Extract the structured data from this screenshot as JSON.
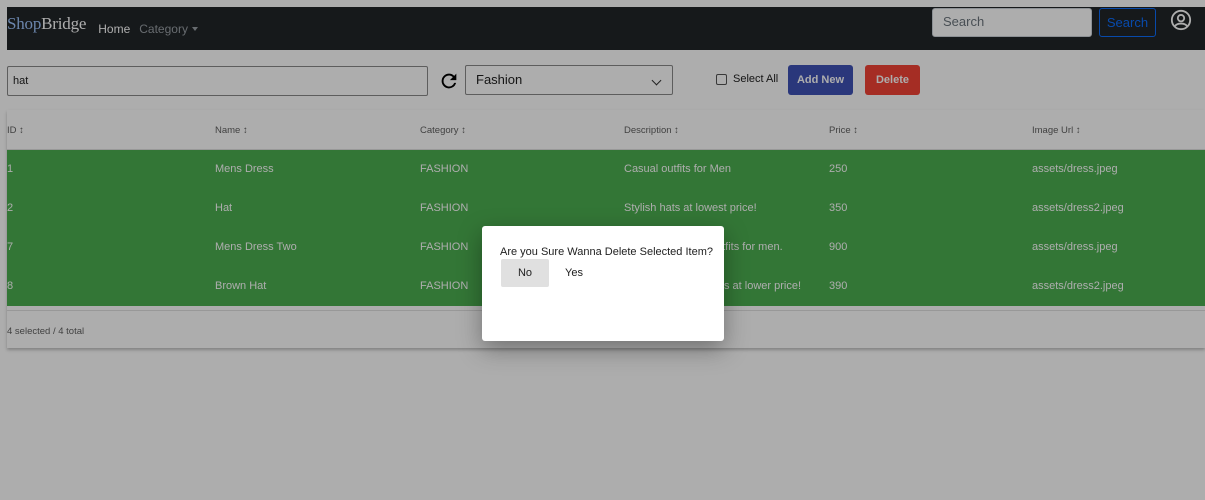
{
  "navbar": {
    "brand_prefix": "Shop",
    "brand_suffix": "Bridge",
    "home": "Home",
    "category": "Category",
    "search_placeholder": "Search",
    "search_button": "Search",
    "icons": {
      "user": "user-circle-icon",
      "caret": "caret-down-icon"
    }
  },
  "toolbar": {
    "search_value": "hat",
    "category_selected": "Fashion",
    "select_all_label": "Select All",
    "add_new_label": "Add New",
    "delete_label": "Delete",
    "icons": {
      "refresh": "refresh-icon",
      "chevron": "chevron-down-icon"
    }
  },
  "table": {
    "columns": [
      "ID",
      "Name",
      "Category",
      "Description",
      "Price",
      "Image Url"
    ],
    "sort_indicator": "↕",
    "rows": [
      [
        "1",
        "Mens Dress",
        "FASHION",
        "Casual outfits for Men",
        "250",
        "assets/dress.jpeg"
      ],
      [
        "2",
        "Hat",
        "FASHION",
        "Stylish hats at lowest price!",
        "350",
        "assets/dress2.jpeg"
      ],
      [
        "7",
        "Mens Dress Two",
        "FASHION",
        "utfits for men.",
        "900",
        "assets/dress.jpeg"
      ],
      [
        "8",
        "Brown Hat",
        "FASHION",
        "s at lower price!",
        "390",
        "assets/dress2.jpeg"
      ]
    ],
    "selection_summary": "4 selected / 4 total"
  },
  "dialog": {
    "message": "Are you Sure Wanna Delete Selected Item?",
    "no_label": "No",
    "yes_label": "Yes"
  },
  "colors": {
    "navbar_bg": "#212529",
    "selected_row": "#4caf50",
    "add_button": "#3f51b5",
    "delete_button": "#f44336",
    "search_button": "#0d6efd"
  }
}
